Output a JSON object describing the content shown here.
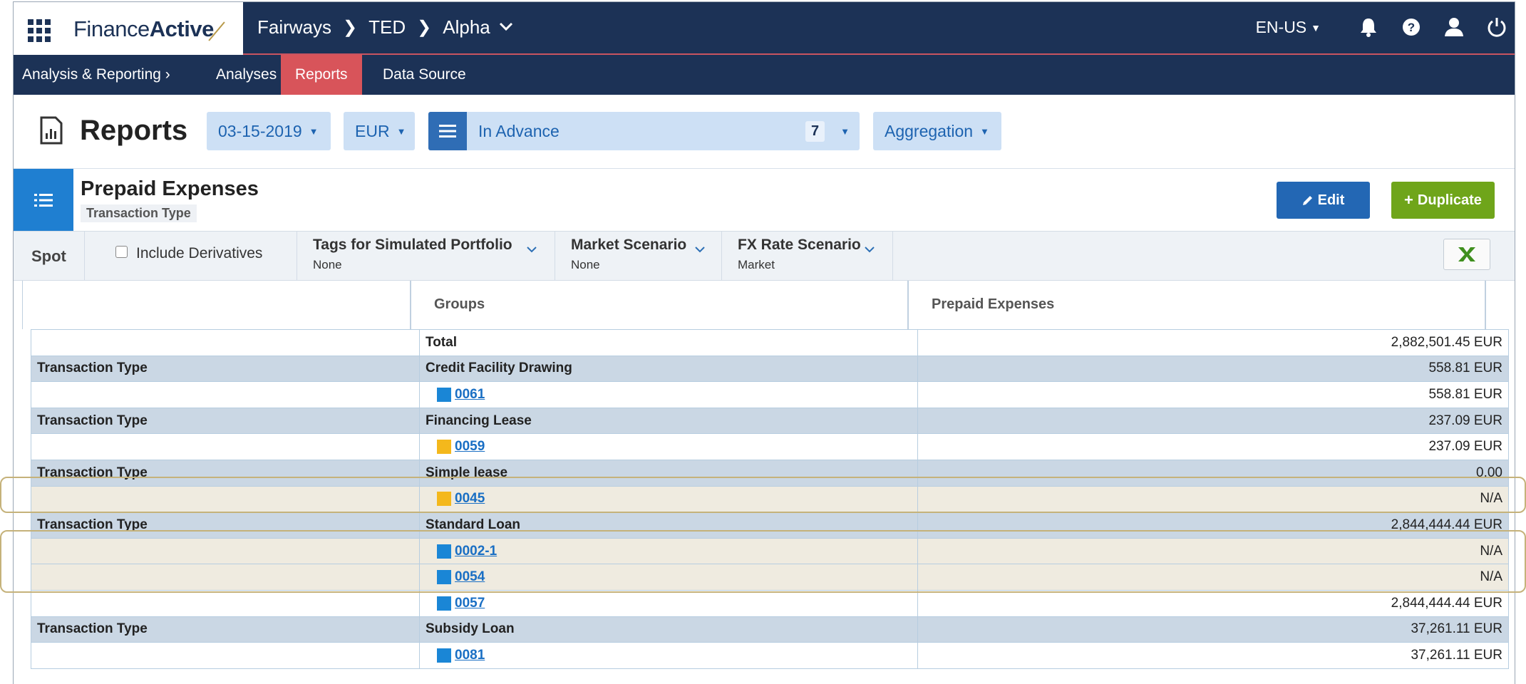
{
  "topbar": {
    "logo_regular": "Finance",
    "logo_bold": "Active",
    "breadcrumbs": [
      "Fairways",
      "TED",
      "Alpha"
    ],
    "language": "EN-US",
    "icons": [
      "apps-grid-icon",
      "bell-icon",
      "help-icon",
      "user-icon",
      "power-icon"
    ]
  },
  "nav": {
    "section": "Analysis & Reporting",
    "items": [
      {
        "label": "Analyses",
        "active": false
      },
      {
        "label": "Reports",
        "active": true
      },
      {
        "label": "Data Source",
        "active": false
      }
    ]
  },
  "header": {
    "title": "Reports",
    "date": "03-15-2019",
    "currency": "EUR",
    "mode": "In Advance",
    "mode_count": "7",
    "aggregation": "Aggregation"
  },
  "report": {
    "title": "Prepaid Expenses",
    "subtitle": "Transaction Type",
    "edit_label": "Edit",
    "duplicate_label": "Duplicate"
  },
  "filters": {
    "spot": "Spot",
    "include_derivatives": "Include Derivatives",
    "tags_label": "Tags for Simulated Portfolio",
    "tags_value": "None",
    "market_label": "Market Scenario",
    "market_value": "None",
    "fx_label": "FX Rate Scenario",
    "fx_value": "Market"
  },
  "table": {
    "col_groups": "Groups",
    "col_value": "Prepaid Expenses",
    "total_label": "Total",
    "total_value": "2,882,501.45 EUR",
    "groups": [
      {
        "type": "Transaction Type",
        "name": "Credit Facility Drawing",
        "value": "558.81 EUR",
        "items": [
          {
            "code": "0061",
            "value": "558.81 EUR",
            "color": "#1a86d6",
            "highlight": false
          }
        ]
      },
      {
        "type": "Transaction Type",
        "name": "Financing Lease",
        "value": "237.09 EUR",
        "items": [
          {
            "code": "0059",
            "value": "237.09 EUR",
            "color": "#f4b81c",
            "highlight": false
          }
        ]
      },
      {
        "type": "Transaction Type",
        "name": "Simple lease",
        "value": "0.00",
        "items": [
          {
            "code": "0045",
            "value": "N/A",
            "color": "#f4b81c",
            "highlight": true
          }
        ]
      },
      {
        "type": "Transaction Type",
        "name": "Standard Loan",
        "value": "2,844,444.44 EUR",
        "items": [
          {
            "code": "0002-1",
            "value": "N/A",
            "color": "#1a86d6",
            "highlight": true
          },
          {
            "code": "0054",
            "value": "N/A",
            "color": "#1a86d6",
            "highlight": true
          },
          {
            "code": "0057",
            "value": "2,844,444.44 EUR",
            "color": "#1a86d6",
            "highlight": false
          }
        ]
      },
      {
        "type": "Transaction Type",
        "name": "Subsidy Loan",
        "value": "37,261.11 EUR",
        "items": [
          {
            "code": "0081",
            "value": "37,261.11 EUR",
            "color": "#1a86d6",
            "highlight": false
          }
        ]
      }
    ]
  }
}
